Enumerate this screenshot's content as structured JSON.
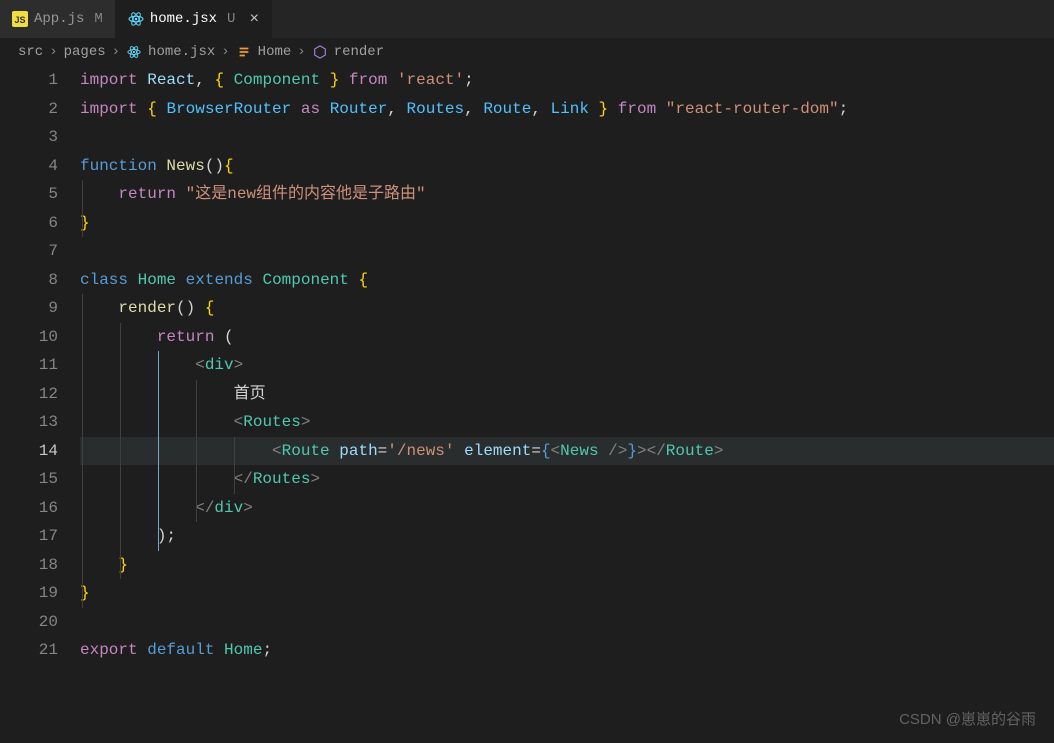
{
  "tabs": [
    {
      "icon": "js",
      "name": "App.js",
      "status": "M",
      "active": false
    },
    {
      "icon": "react",
      "name": "home.jsx",
      "status": "U",
      "active": true
    }
  ],
  "breadcrumbs": {
    "items": [
      {
        "label": "src",
        "icon": ""
      },
      {
        "label": "pages",
        "icon": ""
      },
      {
        "label": "home.jsx",
        "icon": "react"
      },
      {
        "label": "Home",
        "icon": "class"
      },
      {
        "label": "render",
        "icon": "method"
      }
    ],
    "sep": "›"
  },
  "editor": {
    "currentLine": 14,
    "lineCount": 21,
    "lines": [
      [
        {
          "t": "kw1",
          "v": "import"
        },
        {
          "t": "punc",
          "v": " "
        },
        {
          "t": "var1",
          "v": "React"
        },
        {
          "t": "punc",
          "v": ", "
        },
        {
          "t": "brace",
          "v": "{"
        },
        {
          "t": "punc",
          "v": " "
        },
        {
          "t": "type",
          "v": "Component"
        },
        {
          "t": "punc",
          "v": " "
        },
        {
          "t": "brace",
          "v": "}"
        },
        {
          "t": "punc",
          "v": " "
        },
        {
          "t": "kw1",
          "v": "from"
        },
        {
          "t": "punc",
          "v": " "
        },
        {
          "t": "str",
          "v": "'react'"
        },
        {
          "t": "punc",
          "v": ";"
        }
      ],
      [
        {
          "t": "kw1",
          "v": "import"
        },
        {
          "t": "punc",
          "v": " "
        },
        {
          "t": "brace",
          "v": "{"
        },
        {
          "t": "punc",
          "v": " "
        },
        {
          "t": "var2",
          "v": "BrowserRouter"
        },
        {
          "t": "punc",
          "v": " "
        },
        {
          "t": "kw1",
          "v": "as"
        },
        {
          "t": "punc",
          "v": " "
        },
        {
          "t": "var2",
          "v": "Router"
        },
        {
          "t": "punc",
          "v": ", "
        },
        {
          "t": "var2",
          "v": "Routes"
        },
        {
          "t": "punc",
          "v": ", "
        },
        {
          "t": "var2",
          "v": "Route"
        },
        {
          "t": "punc",
          "v": ", "
        },
        {
          "t": "var2",
          "v": "Link"
        },
        {
          "t": "punc",
          "v": " "
        },
        {
          "t": "brace",
          "v": "}"
        },
        {
          "t": "punc",
          "v": " "
        },
        {
          "t": "kw1",
          "v": "from"
        },
        {
          "t": "punc",
          "v": " "
        },
        {
          "t": "str",
          "v": "\"react-router-dom\""
        },
        {
          "t": "punc",
          "v": ";"
        }
      ],
      [],
      [
        {
          "t": "kw2",
          "v": "function"
        },
        {
          "t": "punc",
          "v": " "
        },
        {
          "t": "fn",
          "v": "News"
        },
        {
          "t": "punc",
          "v": "()"
        },
        {
          "t": "brace",
          "v": "{"
        }
      ],
      [
        {
          "t": "punc",
          "v": "    "
        },
        {
          "t": "kw1",
          "v": "return"
        },
        {
          "t": "punc",
          "v": " "
        },
        {
          "t": "str",
          "v": "\"这是new组件的内容他是子路由\""
        }
      ],
      [
        {
          "t": "brace",
          "v": "}"
        }
      ],
      [],
      [
        {
          "t": "kw2",
          "v": "class"
        },
        {
          "t": "punc",
          "v": " "
        },
        {
          "t": "type",
          "v": "Home"
        },
        {
          "t": "punc",
          "v": " "
        },
        {
          "t": "kw2",
          "v": "extends"
        },
        {
          "t": "punc",
          "v": " "
        },
        {
          "t": "type",
          "v": "Component"
        },
        {
          "t": "punc",
          "v": " "
        },
        {
          "t": "brace",
          "v": "{"
        }
      ],
      [
        {
          "t": "punc",
          "v": "    "
        },
        {
          "t": "fn",
          "v": "render"
        },
        {
          "t": "punc",
          "v": "() "
        },
        {
          "t": "brace",
          "v": "{"
        }
      ],
      [
        {
          "t": "punc",
          "v": "        "
        },
        {
          "t": "kw1",
          "v": "return"
        },
        {
          "t": "punc",
          "v": " ("
        }
      ],
      [
        {
          "t": "punc",
          "v": "            "
        },
        {
          "t": "tag-br",
          "v": "<"
        },
        {
          "t": "tag-nm",
          "v": "div"
        },
        {
          "t": "tag-br",
          "v": ">"
        }
      ],
      [
        {
          "t": "punc",
          "v": "                "
        },
        {
          "t": "punc",
          "v": "首页"
        }
      ],
      [
        {
          "t": "punc",
          "v": "                "
        },
        {
          "t": "tag-br",
          "v": "<"
        },
        {
          "t": "tag-nm",
          "v": "Routes"
        },
        {
          "t": "tag-br",
          "v": ">"
        }
      ],
      [
        {
          "t": "punc",
          "v": "                    "
        },
        {
          "t": "tag-br",
          "v": "<"
        },
        {
          "t": "tag-nm",
          "v": "Route"
        },
        {
          "t": "punc",
          "v": " "
        },
        {
          "t": "var1",
          "v": "path"
        },
        {
          "t": "punc",
          "v": "="
        },
        {
          "t": "str",
          "v": "'/news'"
        },
        {
          "t": "punc",
          "v": " "
        },
        {
          "t": "var1",
          "v": "element"
        },
        {
          "t": "punc",
          "v": "="
        },
        {
          "t": "kw2",
          "v": "{"
        },
        {
          "t": "tag-br",
          "v": "<"
        },
        {
          "t": "tag-nm",
          "v": "News"
        },
        {
          "t": "punc",
          "v": " "
        },
        {
          "t": "tag-br",
          "v": "/>"
        },
        {
          "t": "kw2",
          "v": "}"
        },
        {
          "t": "tag-br",
          "v": ">"
        },
        {
          "t": "tag-br",
          "v": "</"
        },
        {
          "t": "tag-nm",
          "v": "Route"
        },
        {
          "t": "tag-br",
          "v": ">"
        }
      ],
      [
        {
          "t": "punc",
          "v": "                "
        },
        {
          "t": "tag-br",
          "v": "</"
        },
        {
          "t": "tag-nm",
          "v": "Routes"
        },
        {
          "t": "tag-br",
          "v": ">"
        }
      ],
      [
        {
          "t": "punc",
          "v": "            "
        },
        {
          "t": "tag-br",
          "v": "</"
        },
        {
          "t": "tag-nm",
          "v": "div"
        },
        {
          "t": "tag-br",
          "v": ">"
        }
      ],
      [
        {
          "t": "punc",
          "v": "        );"
        }
      ],
      [
        {
          "t": "punc",
          "v": "    "
        },
        {
          "t": "brace",
          "v": "}"
        }
      ],
      [
        {
          "t": "brace",
          "v": "}"
        }
      ],
      [],
      [
        {
          "t": "kw1",
          "v": "export"
        },
        {
          "t": "punc",
          "v": " "
        },
        {
          "t": "kw2",
          "v": "default"
        },
        {
          "t": "punc",
          "v": " "
        },
        {
          "t": "type",
          "v": "Home"
        },
        {
          "t": "punc",
          "v": ";"
        }
      ]
    ]
  },
  "watermark": "CSDN @崽崽的谷雨"
}
